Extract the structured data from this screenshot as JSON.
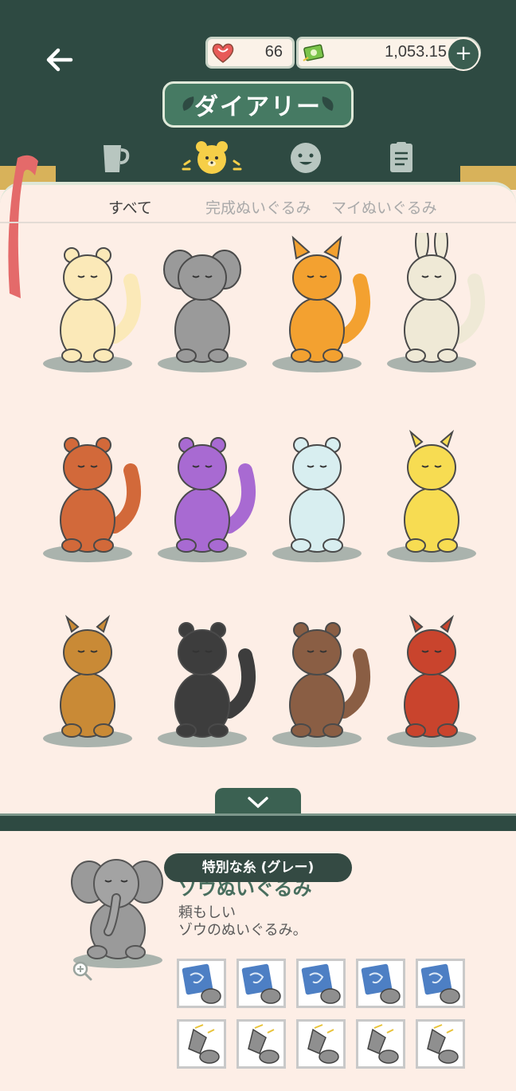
{
  "header": {
    "hearts": "66",
    "money": "1,053.15",
    "plus_label": "+",
    "title": "ダイアリー"
  },
  "tabs": [
    {
      "icon": "cup-icon"
    },
    {
      "icon": "bear-icon",
      "active": true
    },
    {
      "icon": "face-icon"
    },
    {
      "icon": "document-icon"
    }
  ],
  "filters": [
    {
      "label": "すべて",
      "active": true
    },
    {
      "label": "完成ぬいぐるみ",
      "active": false
    },
    {
      "label": "マイぬいぐるみ",
      "active": false
    }
  ],
  "plushies": [
    {
      "kind": "cat",
      "color": "#fbe9b8"
    },
    {
      "kind": "elephant",
      "color": "#9a9a9a"
    },
    {
      "kind": "fox",
      "color": "#f3a130"
    },
    {
      "kind": "rabbit",
      "color": "#efe9d6"
    },
    {
      "kind": "squirrel",
      "color": "#d2693a"
    },
    {
      "kind": "cat",
      "color": "#a86ad2"
    },
    {
      "kind": "bear",
      "color": "#d8eef0"
    },
    {
      "kind": "giraffe",
      "color": "#f7dc52"
    },
    {
      "kind": "deer",
      "color": "#c98a36"
    },
    {
      "kind": "skunk",
      "color": "#3d3d3d"
    },
    {
      "kind": "otter",
      "color": "#8a5e44"
    },
    {
      "kind": "horse",
      "color": "#c9442d"
    }
  ],
  "detail": {
    "tooltip": "特別な糸 (グレー)",
    "name": "ゾウぬいぐるみ",
    "desc_line1": "頼もしい",
    "desc_line2": "ゾウのぬいぐるみ。"
  },
  "materials_row1": [
    "pattern-icon",
    "pattern-icon",
    "pattern-icon",
    "pattern-icon",
    "pattern-icon"
  ],
  "materials_row2": [
    "thread-icon",
    "thread-icon",
    "thread-icon",
    "thread-icon",
    "thread-icon"
  ]
}
